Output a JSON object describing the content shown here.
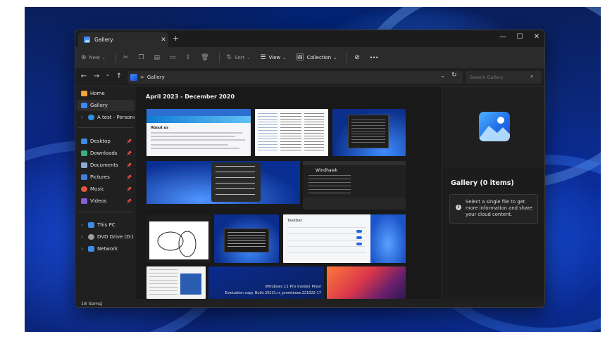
{
  "window": {
    "tab_title": "Gallery",
    "tab_close": "✕",
    "new_tab": "+",
    "minimize": "—",
    "maximize": "☐",
    "close": "✕"
  },
  "command_bar": {
    "new_label": "New",
    "sort_label": "Sort",
    "view_label": "View",
    "collection_label": "Collection",
    "more_label": "•••"
  },
  "address_bar": {
    "back": "←",
    "forward": "→",
    "recent": "⌄",
    "up": "↑",
    "separator": ">",
    "path": "Gallery",
    "dropdown": "⌄",
    "refresh": "↻",
    "search_placeholder": "Search Gallery",
    "search_icon": "⌕"
  },
  "sidebar": {
    "items": [
      {
        "label": "Home",
        "icon": "home-icon",
        "color": "#f2a33a"
      },
      {
        "label": "Gallery",
        "icon": "gallery-icon",
        "color": "#3b8bff"
      },
      {
        "label": "A test - Personal",
        "icon": "onedrive-icon",
        "color": "#2f8de4"
      },
      {
        "label": "Desktop",
        "icon": "desktop-icon",
        "color": "#3a8ee6"
      },
      {
        "label": "Downloads",
        "icon": "downloads-icon",
        "color": "#36b37e"
      },
      {
        "label": "Documents",
        "icon": "documents-icon",
        "color": "#8fa9d8"
      },
      {
        "label": "Pictures",
        "icon": "pictures-icon",
        "color": "#3f7fe0"
      },
      {
        "label": "Music",
        "icon": "music-icon",
        "color": "#e8553d"
      },
      {
        "label": "Videos",
        "icon": "videos-icon",
        "color": "#8a5ad8"
      },
      {
        "label": "This PC",
        "icon": "this-pc-icon",
        "color": "#3a8ee6"
      },
      {
        "label": "DVD Drive (D:) CCC",
        "icon": "dvd-drive-icon",
        "color": "#9aa0a6"
      },
      {
        "label": "Network",
        "icon": "network-icon",
        "color": "#3a8ee6"
      }
    ],
    "pin_glyph": "📌",
    "chevron": "›"
  },
  "content": {
    "range_title": "April 2023 - December 2020",
    "thumb_texts": {
      "about_us": "About us",
      "windhawk": "Windhawk",
      "taskbar": "Taskbar",
      "watermark_line1": "Windows 11 Pro Insider Previ",
      "watermark_line2": "Evaluation copy. Build 25231.rs_prerelease.221022-17"
    }
  },
  "details": {
    "title": "Gallery (0 items)",
    "info_icon": "i",
    "info_text": "Select a single file to get more information and share your cloud content."
  },
  "status_bar": {
    "count": "18 items",
    "caret": "|"
  }
}
